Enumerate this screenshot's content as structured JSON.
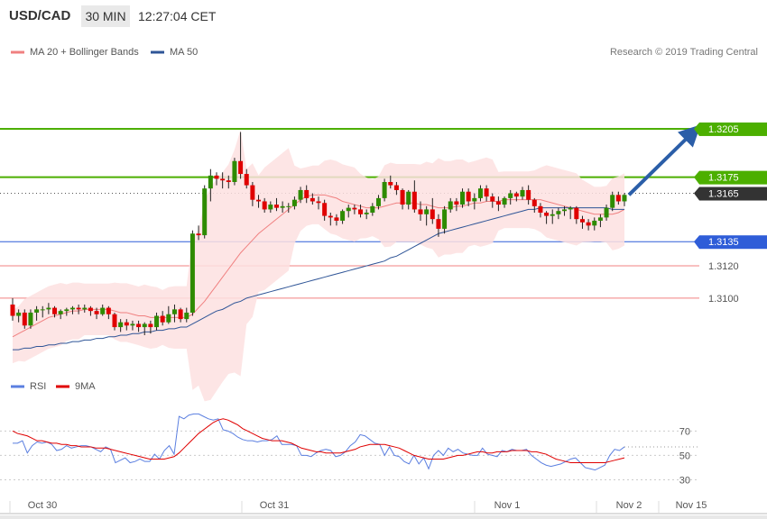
{
  "header": {
    "symbol": "USD/CAD",
    "timeframe": "30 MIN",
    "time": "12:27:04 CET"
  },
  "legend_top": {
    "ma20_label": "MA 20 + Bollinger Bands",
    "ma50_label": "MA 50",
    "ma20_color": "#f08080",
    "ma50_color": "#2f5597"
  },
  "copyright": "Research © 2019 Trading Central",
  "rsi_legend": {
    "rsi_label": "RSI",
    "ma_label": "9MA",
    "rsi_color": "#5b7fe0",
    "ma_color": "#e00000"
  },
  "colors": {
    "up_candle": "#2e8b00",
    "down_candle": "#e00000",
    "target_line": "#4caf00",
    "pivot_line": "#2f5dd8",
    "support_line": "#f08080",
    "arrow": "#2b5ea8"
  },
  "chart_data": [
    {
      "type": "candlestick",
      "xlabel": "",
      "ylabel": "",
      "x_ticks": [
        "Oct 30",
        "Oct 31",
        "Nov 1",
        "Nov 2",
        "Nov 15"
      ],
      "ylim": [
        1.3058,
        1.3229
      ],
      "levels": [
        {
          "label": "1.3205",
          "value": 1.3205,
          "kind": "target"
        },
        {
          "label": "1.3175",
          "value": 1.3175,
          "kind": "target"
        },
        {
          "label": "1.3165",
          "value": 1.3165,
          "kind": "last"
        },
        {
          "label": "1.3135",
          "value": 1.3135,
          "kind": "pivot"
        },
        {
          "label": "1.3120",
          "value": 1.312,
          "kind": "support"
        },
        {
          "label": "1.3100",
          "value": 1.31,
          "kind": "support"
        }
      ],
      "candles": [
        [
          1.3096,
          1.31,
          1.3086,
          1.3089
        ],
        [
          1.3089,
          1.3093,
          1.3085,
          1.3091
        ],
        [
          1.3091,
          1.3093,
          1.3081,
          1.3083
        ],
        [
          1.3083,
          1.3093,
          1.3081,
          1.3091
        ],
        [
          1.3091,
          1.3095,
          1.3086,
          1.3093
        ],
        [
          1.3093,
          1.3095,
          1.3088,
          1.3093
        ],
        [
          1.3093,
          1.3097,
          1.309,
          1.3094
        ],
        [
          1.3094,
          1.3095,
          1.3088,
          1.309
        ],
        [
          1.309,
          1.3093,
          1.3087,
          1.3092
        ],
        [
          1.3092,
          1.3094,
          1.3089,
          1.3093
        ],
        [
          1.3093,
          1.3095,
          1.309,
          1.3094
        ],
        [
          1.3094,
          1.3096,
          1.309,
          1.3093
        ],
        [
          1.3093,
          1.3096,
          1.3091,
          1.3094
        ],
        [
          1.3094,
          1.3095,
          1.3089,
          1.3092
        ],
        [
          1.3092,
          1.3094,
          1.3087,
          1.309
        ],
        [
          1.309,
          1.3096,
          1.3089,
          1.3094
        ],
        [
          1.3094,
          1.3095,
          1.3087,
          1.309
        ],
        [
          1.309,
          1.3091,
          1.308,
          1.3082
        ],
        [
          1.3082,
          1.3087,
          1.3079,
          1.3085
        ],
        [
          1.3085,
          1.3087,
          1.308,
          1.3083
        ],
        [
          1.3083,
          1.3086,
          1.308,
          1.3084
        ],
        [
          1.3084,
          1.3086,
          1.3079,
          1.3082
        ],
        [
          1.3082,
          1.3085,
          1.3077,
          1.3084
        ],
        [
          1.3084,
          1.3086,
          1.3078,
          1.3082
        ],
        [
          1.3082,
          1.3091,
          1.308,
          1.3089
        ],
        [
          1.3089,
          1.3092,
          1.3083,
          1.3085
        ],
        [
          1.3085,
          1.3095,
          1.3084,
          1.309
        ],
        [
          1.309,
          1.3096,
          1.3085,
          1.3093
        ],
        [
          1.3093,
          1.3094,
          1.3085,
          1.3087
        ],
        [
          1.3087,
          1.3094,
          1.3085,
          1.3091
        ],
        [
          1.3091,
          1.3142,
          1.3089,
          1.314
        ],
        [
          1.314,
          1.3145,
          1.3136,
          1.3139
        ],
        [
          1.3139,
          1.317,
          1.3137,
          1.3168
        ],
        [
          1.3168,
          1.318,
          1.316,
          1.3176
        ],
        [
          1.3176,
          1.3178,
          1.317,
          1.3174
        ],
        [
          1.3174,
          1.3178,
          1.3168,
          1.3173
        ],
        [
          1.3173,
          1.3176,
          1.3168,
          1.3172
        ],
        [
          1.3172,
          1.3187,
          1.317,
          1.3185
        ],
        [
          1.3185,
          1.3203,
          1.3174,
          1.3177
        ],
        [
          1.3177,
          1.318,
          1.3168,
          1.317
        ],
        [
          1.317,
          1.3172,
          1.3157,
          1.3161
        ],
        [
          1.3161,
          1.3164,
          1.3156,
          1.316
        ],
        [
          1.316,
          1.3162,
          1.3153,
          1.3155
        ],
        [
          1.3155,
          1.316,
          1.3153,
          1.3158
        ],
        [
          1.3158,
          1.3162,
          1.3154,
          1.3156
        ],
        [
          1.3156,
          1.316,
          1.3153,
          1.3157
        ],
        [
          1.3157,
          1.3159,
          1.3153,
          1.3157
        ],
        [
          1.3157,
          1.3163,
          1.3155,
          1.3161
        ],
        [
          1.3161,
          1.3169,
          1.3159,
          1.3167
        ],
        [
          1.3167,
          1.317,
          1.3159,
          1.3162
        ],
        [
          1.3162,
          1.3165,
          1.3158,
          1.316
        ],
        [
          1.316,
          1.3163,
          1.3155,
          1.3159
        ],
        [
          1.3159,
          1.3161,
          1.3148,
          1.3151
        ],
        [
          1.3151,
          1.3153,
          1.3145,
          1.315
        ],
        [
          1.315,
          1.3152,
          1.3145,
          1.3148
        ],
        [
          1.3148,
          1.3155,
          1.3146,
          1.3154
        ],
        [
          1.3154,
          1.3158,
          1.315,
          1.3156
        ],
        [
          1.3156,
          1.3158,
          1.3152,
          1.3155
        ],
        [
          1.3155,
          1.3158,
          1.315,
          1.3152
        ],
        [
          1.3152,
          1.3155,
          1.3149,
          1.3153
        ],
        [
          1.3153,
          1.3159,
          1.3151,
          1.3157
        ],
        [
          1.3157,
          1.3164,
          1.3155,
          1.3162
        ],
        [
          1.3162,
          1.3174,
          1.316,
          1.3172
        ],
        [
          1.3172,
          1.3176,
          1.3168,
          1.317
        ],
        [
          1.317,
          1.3172,
          1.3164,
          1.3167
        ],
        [
          1.3167,
          1.3168,
          1.3155,
          1.3158
        ],
        [
          1.3158,
          1.3167,
          1.3155,
          1.3166
        ],
        [
          1.3166,
          1.3173,
          1.3153,
          1.3155
        ],
        [
          1.3155,
          1.316,
          1.3148,
          1.3152
        ],
        [
          1.3152,
          1.3157,
          1.3145,
          1.3155
        ],
        [
          1.3155,
          1.3162,
          1.3146,
          1.3149
        ],
        [
          1.3149,
          1.3152,
          1.3138,
          1.3143
        ],
        [
          1.3143,
          1.3157,
          1.314,
          1.3155
        ],
        [
          1.3155,
          1.3162,
          1.3153,
          1.316
        ],
        [
          1.316,
          1.3162,
          1.3154,
          1.3158
        ],
        [
          1.3158,
          1.3168,
          1.3156,
          1.3166
        ],
        [
          1.3166,
          1.3168,
          1.3157,
          1.316
        ],
        [
          1.316,
          1.3165,
          1.3155,
          1.3162
        ],
        [
          1.3162,
          1.317,
          1.316,
          1.3168
        ],
        [
          1.3168,
          1.317,
          1.316,
          1.3163
        ],
        [
          1.3163,
          1.3165,
          1.3156,
          1.316
        ],
        [
          1.316,
          1.3163,
          1.3154,
          1.3158
        ],
        [
          1.3158,
          1.3163,
          1.3156,
          1.3162
        ],
        [
          1.3162,
          1.3167,
          1.3158,
          1.3165
        ],
        [
          1.3165,
          1.3166,
          1.316,
          1.3163
        ],
        [
          1.3163,
          1.3169,
          1.3161,
          1.3167
        ],
        [
          1.3167,
          1.317,
          1.3158,
          1.3161
        ],
        [
          1.3161,
          1.3162,
          1.3153,
          1.3157
        ],
        [
          1.3157,
          1.3159,
          1.315,
          1.3153
        ],
        [
          1.3153,
          1.3154,
          1.3146,
          1.3151
        ],
        [
          1.3151,
          1.3155,
          1.3146,
          1.3152
        ],
        [
          1.3152,
          1.3156,
          1.3149,
          1.3154
        ],
        [
          1.3154,
          1.3157,
          1.3151,
          1.3155
        ],
        [
          1.3155,
          1.3157,
          1.3149,
          1.3156
        ],
        [
          1.3156,
          1.3157,
          1.3146,
          1.3149
        ],
        [
          1.3149,
          1.3151,
          1.3143,
          1.3147
        ],
        [
          1.3147,
          1.3149,
          1.3142,
          1.3145
        ],
        [
          1.3145,
          1.315,
          1.3142,
          1.3148
        ],
        [
          1.3148,
          1.3152,
          1.3144,
          1.315
        ],
        [
          1.315,
          1.3158,
          1.3148,
          1.3156
        ],
        [
          1.3156,
          1.3166,
          1.3154,
          1.3164
        ],
        [
          1.3164,
          1.3166,
          1.3158,
          1.316
        ],
        [
          1.316,
          1.3165,
          1.3157,
          1.3164
        ]
      ],
      "series": [
        {
          "name": "MA 20 + Bollinger Bands",
          "values": [
            1.3076,
            1.3078,
            1.308,
            1.3082,
            1.3084,
            1.3086,
            1.3088,
            1.3089,
            1.309,
            1.3091,
            1.3092,
            1.3092,
            1.3093,
            1.3093,
            1.3093,
            1.3093,
            1.3093,
            1.3092,
            1.3091,
            1.3091,
            1.309,
            1.3089,
            1.3089,
            1.3088,
            1.3088,
            1.3088,
            1.3088,
            1.3088,
            1.3088,
            1.3088,
            1.309,
            1.3094,
            1.3098,
            1.3103,
            1.3108,
            1.3113,
            1.3118,
            1.3123,
            1.3128,
            1.3132,
            1.3136,
            1.314,
            1.3143,
            1.3146,
            1.3149,
            1.3152,
            1.3155,
            1.3158,
            1.3161,
            1.3163,
            1.3164,
            1.3164,
            1.3164,
            1.3163,
            1.3162,
            1.316,
            1.3159,
            1.3158,
            1.3157,
            1.3156,
            1.3156,
            1.3156,
            1.3157,
            1.3158,
            1.3159,
            1.3159,
            1.3159,
            1.3159,
            1.3158,
            1.3158,
            1.3157,
            1.3156,
            1.3156,
            1.3156,
            1.3157,
            1.3157,
            1.3158,
            1.3159,
            1.3159,
            1.316,
            1.316,
            1.316,
            1.3161,
            1.3161,
            1.3161,
            1.3161,
            1.3161,
            1.3161,
            1.3161,
            1.316,
            1.3159,
            1.3158,
            1.3157,
            1.3156,
            1.3155,
            1.3154,
            1.3153,
            1.3152,
            1.3152,
            1.3152,
            1.3152,
            1.3153,
            1.3155
          ]
        },
        {
          "name": "MA 50",
          "values": [
            1.3068,
            1.3068,
            1.3069,
            1.3069,
            1.307,
            1.307,
            1.3071,
            1.3071,
            1.3072,
            1.3072,
            1.3073,
            1.3073,
            1.3074,
            1.3074,
            1.3075,
            1.3075,
            1.3076,
            1.3076,
            1.3077,
            1.3077,
            1.3078,
            1.3078,
            1.3079,
            1.3079,
            1.308,
            1.308,
            1.3081,
            1.3081,
            1.3082,
            1.3082,
            1.3084,
            1.3086,
            1.3088,
            1.309,
            1.3092,
            1.3093,
            1.3095,
            1.3097,
            1.3098,
            1.31,
            1.3101,
            1.3102,
            1.3103,
            1.3104,
            1.3105,
            1.3106,
            1.3107,
            1.3108,
            1.3109,
            1.311,
            1.3111,
            1.3112,
            1.3113,
            1.3114,
            1.3115,
            1.3116,
            1.3117,
            1.3118,
            1.3119,
            1.312,
            1.3121,
            1.3122,
            1.3123,
            1.3125,
            1.3126,
            1.3128,
            1.313,
            1.3132,
            1.3134,
            1.3136,
            1.3138,
            1.314,
            1.3141,
            1.3142,
            1.3143,
            1.3144,
            1.3145,
            1.3146,
            1.3147,
            1.3148,
            1.3149,
            1.315,
            1.3151,
            1.3152,
            1.3153,
            1.3154,
            1.3155,
            1.3155,
            1.3156,
            1.3156,
            1.3156,
            1.3156,
            1.3156,
            1.3156,
            1.3156,
            1.3156,
            1.3156,
            1.3156,
            1.3156,
            1.3156,
            1.3155,
            1.3155,
            1.3155
          ]
        }
      ]
    },
    {
      "type": "line",
      "xlabel": "",
      "ylabel": "",
      "ylim": [
        20,
        88
      ],
      "y_ticks": [
        "70",
        "50",
        "30"
      ],
      "series": [
        {
          "name": "RSI",
          "values": [
            60,
            60,
            62,
            52,
            58,
            61,
            60,
            61,
            59,
            54,
            55,
            58,
            56,
            57,
            58,
            58,
            57,
            55,
            53,
            57,
            55,
            44,
            46,
            48,
            44,
            45,
            47,
            45,
            45,
            51,
            47,
            54,
            58,
            51,
            82,
            80,
            83,
            84,
            84,
            82,
            80,
            79,
            80,
            71,
            70,
            68,
            65,
            63,
            62,
            62,
            61,
            62,
            62,
            63,
            66,
            59,
            59,
            59,
            58,
            50,
            50,
            49,
            52,
            54,
            55,
            54,
            49,
            50,
            53,
            58,
            61,
            67,
            66,
            63,
            60,
            59,
            50,
            57,
            50,
            49,
            45,
            43,
            50,
            43,
            48,
            39,
            50,
            54,
            50,
            56,
            53,
            55,
            52,
            51,
            50,
            50,
            56,
            51,
            50,
            49,
            54,
            53,
            55,
            54,
            54,
            55,
            50,
            47,
            44,
            42,
            41,
            42,
            43,
            45,
            47,
            48,
            44,
            40,
            39,
            38,
            40,
            42,
            50,
            55,
            54,
            57
          ]
        },
        {
          "name": "9MA",
          "values": [
            70,
            68,
            67,
            66,
            64,
            62,
            62,
            61,
            60,
            60,
            59,
            59,
            58,
            58,
            57,
            57,
            57,
            56,
            56,
            56,
            55,
            54,
            53,
            52,
            51,
            50,
            49,
            48,
            47,
            47,
            47,
            47,
            48,
            49,
            52,
            56,
            60,
            64,
            68,
            71,
            74,
            77,
            79,
            80,
            79,
            77,
            75,
            72,
            70,
            68,
            66,
            64,
            63,
            62,
            62,
            62,
            61,
            60,
            58,
            56,
            55,
            54,
            53,
            53,
            52,
            52,
            52,
            52,
            53,
            54,
            55,
            57,
            58,
            59,
            59,
            59,
            59,
            58,
            57,
            56,
            54,
            52,
            50,
            49,
            48,
            47,
            47,
            47,
            47,
            48,
            49,
            50,
            50,
            51,
            52,
            53,
            53,
            52,
            52,
            53,
            53,
            53,
            54,
            54,
            54,
            54,
            53,
            53,
            52,
            51,
            49,
            47,
            46,
            45,
            44,
            44,
            44,
            44,
            44,
            44,
            44,
            44,
            45,
            46,
            47,
            48
          ]
        }
      ]
    }
  ]
}
